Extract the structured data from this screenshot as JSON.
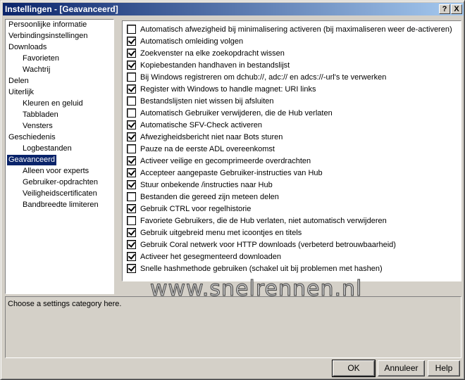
{
  "window": {
    "title": "Instellingen - [Geavanceerd]",
    "help_glyph": "?",
    "close_glyph": "X"
  },
  "tree": [
    {
      "label": "Persoonlijke informatie",
      "level": 0
    },
    {
      "label": "Verbindingsinstellingen",
      "level": 0
    },
    {
      "label": "Downloads",
      "level": 0
    },
    {
      "label": "Favorieten",
      "level": 1
    },
    {
      "label": "Wachtrij",
      "level": 1
    },
    {
      "label": "Delen",
      "level": 0
    },
    {
      "label": "Uiterlijk",
      "level": 0
    },
    {
      "label": "Kleuren en geluid",
      "level": 1
    },
    {
      "label": "Tabbladen",
      "level": 1
    },
    {
      "label": "Vensters",
      "level": 1
    },
    {
      "label": "Geschiedenis",
      "level": 0
    },
    {
      "label": "Logbestanden",
      "level": 1
    },
    {
      "label": "Geavanceerd",
      "level": 0,
      "selected": true
    },
    {
      "label": "Alleen voor experts",
      "level": 1
    },
    {
      "label": "Gebruiker-opdrachten",
      "level": 1
    },
    {
      "label": "Veiligheidscertificaten",
      "level": 1
    },
    {
      "label": "Bandbreedte limiteren",
      "level": 1
    }
  ],
  "options": [
    {
      "label": "Automatisch afwezigheid bij minimalisering activeren (bij maximaliseren weer de-activeren)",
      "checked": false
    },
    {
      "label": "Automatisch omleiding volgen",
      "checked": true
    },
    {
      "label": "Zoekvenster na elke zoekopdracht wissen",
      "checked": true
    },
    {
      "label": "Kopiebestanden handhaven in bestandslijst",
      "checked": true
    },
    {
      "label": "Bij Windows registreren om dchub://, adc:// en adcs://-url's te verwerken",
      "checked": false
    },
    {
      "label": "Register with Windows to handle magnet: URI links",
      "checked": true
    },
    {
      "label": "Bestandslijsten niet wissen bij afsluiten",
      "checked": false
    },
    {
      "label": "Automatisch Gebruiker verwijderen, die de Hub verlaten",
      "checked": false
    },
    {
      "label": "Automatische SFV-Check activeren",
      "checked": true
    },
    {
      "label": "Afwezigheidsbericht niet naar Bots sturen",
      "checked": true
    },
    {
      "label": "Pauze na de eerste ADL overeenkomst",
      "checked": false
    },
    {
      "label": "Activeer veilige en gecomprimeerde overdrachten",
      "checked": true
    },
    {
      "label": "Accepteer aangepaste Gebruiker-instructies van Hub",
      "checked": true
    },
    {
      "label": "Stuur onbekende /instructies naar Hub",
      "checked": true
    },
    {
      "label": "Bestanden die gereed zijn meteen delen",
      "checked": false
    },
    {
      "label": "Gebruik CTRL voor regelhistorie",
      "checked": true
    },
    {
      "label": "Favoriete Gebruikers, die de Hub verlaten, niet automatisch verwijderen",
      "checked": false
    },
    {
      "label": "Gebruik uitgebreid menu met icoontjes en titels",
      "checked": true
    },
    {
      "label": "Gebruik Coral netwerk voor HTTP downloads (verbeterd betrouwbaarheid)",
      "checked": true
    },
    {
      "label": "Activeer het gesegmenteerd downloaden",
      "checked": true
    },
    {
      "label": "Snelle hashmethode gebruiken (schakel uit bij problemen met hashen)",
      "checked": true
    }
  ],
  "watermark": "www.snelrennen.nl",
  "status": "Choose a settings category here.",
  "buttons": {
    "ok": "OK",
    "cancel": "Annuleer",
    "help": "Help"
  }
}
